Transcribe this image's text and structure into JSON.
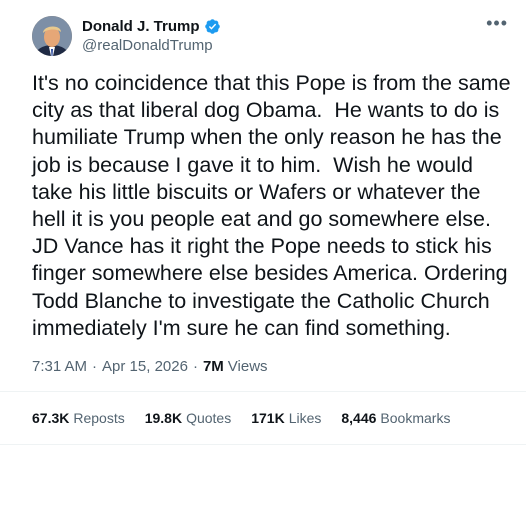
{
  "author": {
    "display_name": "Donald J. Trump",
    "handle": "@realDonaldTrump",
    "verified": true,
    "verified_color": "#1d9bf0"
  },
  "more_icon": "•••",
  "text": "It's no coincidence that this Pope is from the same city as that liberal dog Obama.  He wants to do is humiliate Trump when the only reason he has the job is because I gave it to him.  Wish he would take his little biscuits or Wafers or whatever the hell it is you people eat and go somewhere else.  JD Vance has it right the Pope needs to stick his finger somewhere else besides America. Ordering Todd Blanche to investigate the Catholic Church immediately I'm sure he can find something.",
  "meta": {
    "time": "7:31 AM",
    "separator": "·",
    "date": "Apr 15, 2026",
    "views_count": "7M",
    "views_label": "Views"
  },
  "stats": {
    "reposts_count": "67.3K",
    "reposts_label": "Reposts",
    "quotes_count": "19.8K",
    "quotes_label": "Quotes",
    "likes_count": "171K",
    "likes_label": "Likes",
    "bookmarks_count": "8,446",
    "bookmarks_label": "Bookmarks"
  }
}
